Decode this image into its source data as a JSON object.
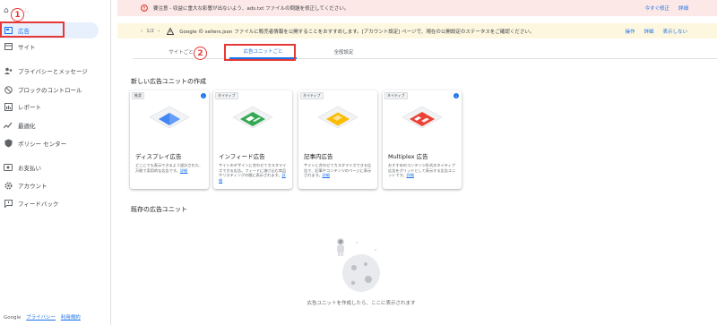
{
  "sidebar": {
    "top_label": "ホーム",
    "items": [
      {
        "label": "広告",
        "icon": "ads-icon",
        "active": true
      },
      {
        "label": "サイト",
        "icon": "sites-icon"
      },
      {
        "label": "プライバシーとメッセージ",
        "icon": "privacy-icon"
      },
      {
        "label": "ブロックのコントロール",
        "icon": "block-icon"
      },
      {
        "label": "レポート",
        "icon": "reports-icon"
      },
      {
        "label": "最適化",
        "icon": "optimize-icon"
      },
      {
        "label": "ポリシー センター",
        "icon": "policy-icon"
      },
      {
        "label": "お支払い",
        "icon": "payments-icon"
      },
      {
        "label": "アカウント",
        "icon": "account-icon"
      },
      {
        "label": "フィードバック",
        "icon": "feedback-icon"
      }
    ],
    "footer": {
      "brand": "Google",
      "privacy": "プライバシー",
      "terms": "利用規約"
    }
  },
  "annotations": {
    "one": "1",
    "two": "2"
  },
  "banners": {
    "red": {
      "text": "要注意 - 収益に重大な影響が出ないよう、ads.txt ファイルの問題を修正してください。",
      "action1": "今すぐ修正",
      "action2": "詳細"
    },
    "yellow": {
      "pager": "1/2",
      "text": "Google の sellers.json ファイルに販売者情報を公開することをおすすめします。[アカウント設定] ページで、現在の公開設定のステータスをご確認ください。",
      "action1": "操作",
      "action2": "詳細",
      "action3": "表示しない"
    }
  },
  "tabs": [
    "サイトごと",
    "広告ユニットごと",
    "全般設定"
  ],
  "create_section": {
    "title": "新しい広告ユニットの作成",
    "cards": [
      {
        "chip": "推奨",
        "title": "ディスプレイ広告",
        "desc": "どこにでも表示できるよう設計された、万能で実用的な広告です。",
        "link": "詳細",
        "info": true,
        "color": "#4285f4"
      },
      {
        "chip": "ネイティブ",
        "title": "インフィード広告",
        "desc": "サイトのデザインに合わせてカスタマイズできる広告。フィードに溶け込む商品やリスティングの間に表示されます。",
        "link": "詳細",
        "info": false,
        "color": "#34a853"
      },
      {
        "chip": "ネイティブ",
        "title": "記事内広告",
        "desc": "サイトに合わせてカスタマイズできる広告で、記事やコンテンツのページに表示されます。",
        "link": "詳細",
        "info": false,
        "color": "#fbbc04"
      },
      {
        "chip": "ネイティブ",
        "title": "Multiplex 広告",
        "desc": "おすすめのコンテンツ形式のネイティブ広告をグリッドとして表示する広告ユニットです。",
        "link": "詳細",
        "info": true,
        "color": "#ea4335"
      }
    ]
  },
  "existing_section": {
    "title": "既存の広告ユニット",
    "empty_text": "広告ユニットを作成したら、ここに表示されます"
  }
}
